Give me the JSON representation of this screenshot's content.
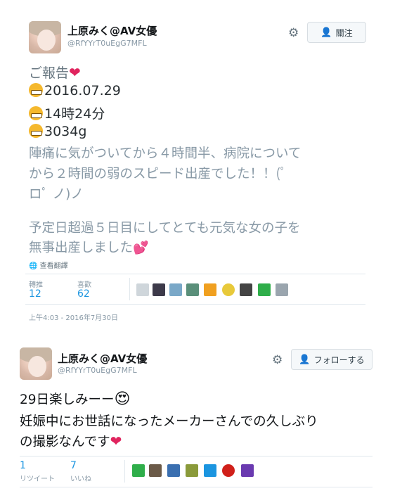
{
  "tweet1": {
    "name": "上原みく@AV女優",
    "handle": "@RfYYrT0uEgG7MFL",
    "follow_label": "關注",
    "lines": {
      "l1": "ご報告",
      "l2": "2016.07.29",
      "l3": "14時24分",
      "l4": "3034g",
      "l5": "陣痛に気がついてから４時間半、病院について",
      "l6": "から２時間の弱のスピード出産でした！！(ﾟ",
      "l7": "ロﾟ ノ)ノ",
      "l8": "予定日超過５日目にしてとても元気な女の子を",
      "l9": "無事出産しました"
    },
    "translate_label": "查看翻譯",
    "retweets_label": "轉推",
    "retweets_count": "12",
    "likes_label": "喜歡",
    "likes_count": "62",
    "timestamp": "上午4:03 - 2016年7月30日"
  },
  "tweet2": {
    "name": "上原みく@AV女優",
    "handle": "@RfYYrT0uEgG7MFL",
    "follow_label": "フォローする",
    "lines": {
      "l1": "29日楽しみーー",
      "l2": "妊娠中にお世話になったメーカーさんでの久しぶり",
      "l3": "の撮影なんです"
    },
    "retweets_label": "リツイート",
    "retweets_count": "1",
    "likes_label": "いいね",
    "likes_count": "7"
  },
  "icons": {
    "settings": "gear-icon",
    "follow": "add-user-icon",
    "translate": "globe-icon",
    "heart": "heart-emoji",
    "grin": "grinning-face-emoji",
    "heart_eyes": "heart-eyes-emoji"
  },
  "colors": {
    "link_blue": "#1b95e0",
    "heart_red": "#e0245e",
    "muted_gray": "#8899a6"
  }
}
